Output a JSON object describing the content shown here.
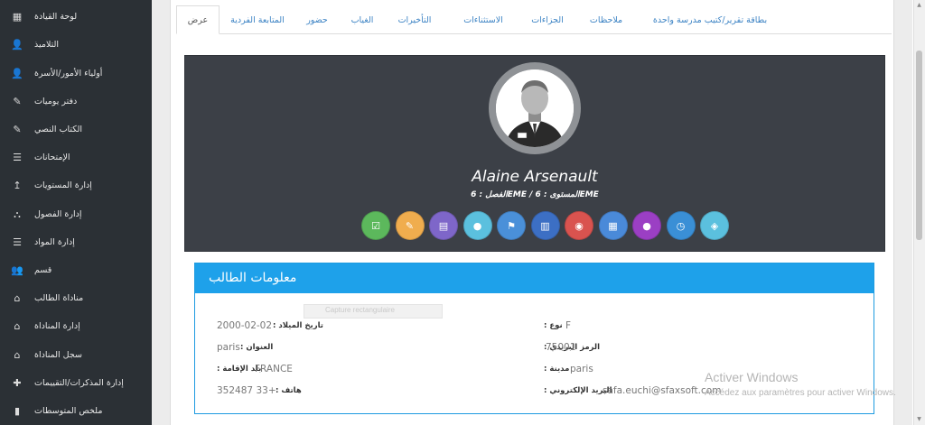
{
  "sidebar": {
    "items": [
      {
        "label": "لوحة القيادة",
        "icon": "home-icon"
      },
      {
        "label": "التلاميذ",
        "icon": "student-icon"
      },
      {
        "label": "أولياء الأمور/الأسرة",
        "icon": "parent-icon"
      },
      {
        "label": "دفتر يوميات",
        "icon": "edit-icon"
      },
      {
        "label": "الكتاب النصي",
        "icon": "edit-icon"
      },
      {
        "label": "الإمتحانات",
        "icon": "list-icon"
      },
      {
        "label": "إدارة المستويات",
        "icon": "level-icon"
      },
      {
        "label": "إدارة الفصول",
        "icon": "sitemap-icon"
      },
      {
        "label": "إدارة المواد",
        "icon": "list-icon"
      },
      {
        "label": "قسم",
        "icon": "users-icon"
      },
      {
        "label": "مناداة الطالب",
        "icon": "bank-icon"
      },
      {
        "label": "إدارة المناداة",
        "icon": "bank-icon"
      },
      {
        "label": "سجل المناداة",
        "icon": "bank-icon"
      },
      {
        "label": "إدارة المذكرات/التقييمات",
        "icon": "tool-icon"
      },
      {
        "label": "ملخص المتوسطات",
        "icon": "chart-icon"
      }
    ]
  },
  "tabs": [
    {
      "label": "عرض",
      "active": true
    },
    {
      "label": "المتابعة الفردية"
    },
    {
      "label": "حضور"
    },
    {
      "label": "الغياب"
    },
    {
      "label": "التأخيرات"
    },
    {
      "label": "الاستثناءات"
    },
    {
      "label": "الجزاءات"
    },
    {
      "label": "ملاحظات"
    },
    {
      "label": "بطاقة تقرير/كتيب مدرسة واحدة"
    }
  ],
  "profile": {
    "name": "Alaine Arsenault",
    "subline": "EMEالمستوى : 6 / EMEالفصل : 6"
  },
  "actions": [
    {
      "icon": "check-icon",
      "color": "#5cb85c"
    },
    {
      "icon": "edit-icon",
      "color": "#f0ad4e"
    },
    {
      "icon": "document-icon",
      "color": "#7e66c9"
    },
    {
      "icon": "user-icon",
      "color": "#5bc0de"
    },
    {
      "icon": "flag-icon",
      "color": "#4a90d9"
    },
    {
      "icon": "file-icon",
      "color": "#3c6fc4"
    },
    {
      "icon": "eye-icon",
      "color": "#d9534f"
    },
    {
      "icon": "calendar-icon",
      "color": "#4a8ad9"
    },
    {
      "icon": "comment-icon",
      "color": "#9b3fc4"
    },
    {
      "icon": "clock-icon",
      "color": "#3a8fd6"
    },
    {
      "icon": "tag-icon",
      "color": "#5bc0de"
    }
  ],
  "info": {
    "title": "معلومات الطالب",
    "ghost_text": "Capture rectangulaire",
    "fields": {
      "gender": {
        "label": "نوع :",
        "value": "F"
      },
      "birthdate": {
        "label": "تاريخ الميلاد :",
        "value": "2000-02-02"
      },
      "postal": {
        "label": "الرمز البريدي :",
        "value": "75001"
      },
      "address": {
        "label": "العنوان :",
        "value": "paris"
      },
      "city": {
        "label": "مدينة :",
        "value": "paris"
      },
      "country": {
        "label": "بلد الإقامة :",
        "value": "FRANCE"
      },
      "email": {
        "label": "البريد الإلكتروني :",
        "value": "safa.euchi@sfaxsoft.com"
      },
      "phone": {
        "label": "هاتف :",
        "value": "+33 352487"
      }
    }
  },
  "watermark": {
    "line1": "Activer Windows",
    "line2": "Accédez aux paramètres pour activer Windows."
  }
}
